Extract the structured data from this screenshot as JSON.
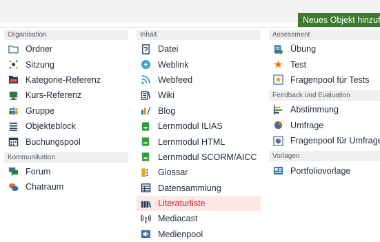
{
  "toolbar": {
    "add_object_label": "Neues Objekt hinzufügen"
  },
  "columns": [
    {
      "groups": [
        {
          "title": "Organisation",
          "items": [
            {
              "label": "Ordner",
              "icon": "folder-icon"
            },
            {
              "label": "Sitzung",
              "icon": "session-icon"
            },
            {
              "label": "Kategorie-Referenz",
              "icon": "category-reference-icon"
            },
            {
              "label": "Kurs-Referenz",
              "icon": "course-reference-icon"
            },
            {
              "label": "Gruppe",
              "icon": "group-icon"
            },
            {
              "label": "Objekteblock",
              "icon": "item-group-icon"
            },
            {
              "label": "Buchungspool",
              "icon": "booking-pool-icon"
            }
          ]
        },
        {
          "title": "Kommunikation",
          "items": [
            {
              "label": "Forum",
              "icon": "forum-icon"
            },
            {
              "label": "Chatraum",
              "icon": "chatroom-icon"
            }
          ]
        }
      ]
    },
    {
      "groups": [
        {
          "title": "Inhalt",
          "items": [
            {
              "label": "Datei",
              "icon": "file-icon"
            },
            {
              "label": "Weblink",
              "icon": "weblink-icon"
            },
            {
              "label": "Webfeed",
              "icon": "webfeed-icon"
            },
            {
              "label": "Wiki",
              "icon": "wiki-icon"
            },
            {
              "label": "Blog",
              "icon": "blog-icon"
            },
            {
              "label": "Lernmodul ILIAS",
              "icon": "learning-module-icon"
            },
            {
              "label": "Lernmodul HTML",
              "icon": "learning-module-html-icon"
            },
            {
              "label": "Lernmodul SCORM/AICC",
              "icon": "learning-module-scorm-icon"
            },
            {
              "label": "Glossar",
              "icon": "glossary-icon"
            },
            {
              "label": "Datensammlung",
              "icon": "data-collection-icon"
            },
            {
              "label": "Literaturliste",
              "icon": "bibliography-icon",
              "highlighted": true
            },
            {
              "label": "Mediacast",
              "icon": "mediacast-icon"
            },
            {
              "label": "Medienpool",
              "icon": "media-pool-icon"
            }
          ]
        }
      ]
    },
    {
      "groups": [
        {
          "title": "Assessment",
          "items": [
            {
              "label": "Übung",
              "icon": "exercise-icon"
            },
            {
              "label": "Test",
              "icon": "test-icon"
            },
            {
              "label": "Fragenpool für Tests",
              "icon": "question-pool-icon"
            }
          ]
        },
        {
          "title": "Feedback und Evaluation",
          "items": [
            {
              "label": "Abstimmung",
              "icon": "poll-icon"
            },
            {
              "label": "Umfrage",
              "icon": "survey-icon"
            },
            {
              "label": "Fragenpool für Umfragen",
              "icon": "survey-question-pool-icon"
            }
          ]
        },
        {
          "title": "Vorlagen",
          "items": [
            {
              "label": "Portfoliovorlage",
              "icon": "portfolio-template-icon"
            }
          ]
        }
      ]
    }
  ],
  "colors": {
    "button_bg": "#3d7a2d",
    "highlight_bg": "#fde8e8",
    "highlight_text": "#c0282f"
  }
}
